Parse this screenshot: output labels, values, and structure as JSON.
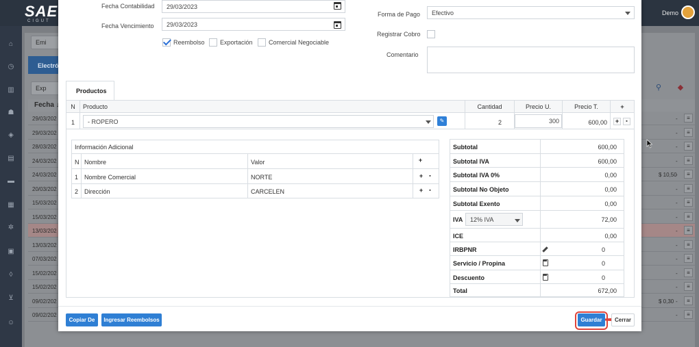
{
  "app": {
    "logo": "SAE",
    "logo_sub": "CIGUT",
    "user": "Demo",
    "bg_buttons": {
      "top_btn": "Emi",
      "tab": "Electró",
      "export_btn": "Exp"
    },
    "bg_table": {
      "header": "Fecha ↓",
      "rows": [
        {
          "date": "29/03/202",
          "dash": "-",
          "amount": ""
        },
        {
          "date": "29/03/202",
          "dash": "-",
          "amount": ""
        },
        {
          "date": "28/03/202",
          "dash": "-",
          "amount": ""
        },
        {
          "date": "24/03/202",
          "dash": "-",
          "amount": ""
        },
        {
          "date": "24/03/202",
          "dash": "-",
          "amount": "$ 10,50"
        },
        {
          "date": "20/03/202",
          "dash": "-",
          "amount": ""
        },
        {
          "date": "15/03/202",
          "dash": "-",
          "amount": ""
        },
        {
          "date": "15/03/202",
          "dash": "-",
          "amount": ""
        },
        {
          "date": "13/03/202",
          "dash": "-",
          "amount": ""
        },
        {
          "date": "13/03/202",
          "dash": "-",
          "amount": ""
        },
        {
          "date": "07/03/202",
          "dash": "-",
          "amount": ""
        },
        {
          "date": "15/02/202",
          "dash": "-",
          "amount": ""
        },
        {
          "date": "15/02/202",
          "dash": "-",
          "amount": ""
        },
        {
          "date": "09/02/202",
          "dash": "-",
          "amount": "$ 0,30"
        },
        {
          "date": "09/02/202",
          "dash": "-",
          "amount": ""
        }
      ]
    }
  },
  "form": {
    "fecha_contabilidad_label": "Fecha Contabilidad",
    "fecha_contabilidad_value": "29/03/2023",
    "fecha_vencimiento_label": "Fecha Vencimiento",
    "fecha_vencimiento_value": "29/03/2023",
    "reembolso_label": "Reembolso",
    "exportacion_label": "Exportación",
    "comercial_label": "Comercial Negociable",
    "forma_pago_label": "Forma de Pago",
    "forma_pago_value": "Efectivo",
    "registrar_cobro_label": "Registrar Cobro",
    "comentario_label": "Comentario"
  },
  "products": {
    "tab_label": "Productos",
    "headers": {
      "n": "N",
      "producto": "Producto",
      "cantidad": "Cantidad",
      "precio_u": "Precio U.",
      "precio_t": "Precio T.",
      "add": "+"
    },
    "rows": [
      {
        "n": "1",
        "producto": "- ROPERO",
        "cantidad": "2",
        "precio_u": "300",
        "precio_t": "600,00"
      }
    ]
  },
  "info": {
    "title": "Información Adicional",
    "headers": {
      "n": "N",
      "nombre": "Nombre",
      "valor": "Valor"
    },
    "rows": [
      {
        "n": "1",
        "nombre": "Nombre Comercial",
        "valor": "NORTE"
      },
      {
        "n": "2",
        "nombre": "Dirección",
        "valor": "CARCELEN"
      }
    ]
  },
  "totals": {
    "subtotal": {
      "label": "Subtotal",
      "value": "600,00"
    },
    "subtotal_iva": {
      "label": "Subtotal IVA",
      "value": "600,00"
    },
    "subtotal_iva0": {
      "label": "Subtotal IVA 0%",
      "value": "0,00"
    },
    "subtotal_no_objeto": {
      "label": "Subtotal No Objeto",
      "value": "0,00"
    },
    "subtotal_exento": {
      "label": "Subtotal Exento",
      "value": "0,00"
    },
    "iva": {
      "label": "IVA",
      "select": "12% IVA",
      "value": "72,00"
    },
    "ice": {
      "label": "ICE",
      "value": "0,00"
    },
    "irbpnr": {
      "label": "IRBPNR",
      "value": "0"
    },
    "servicio": {
      "label": "Servicio / Propina",
      "value": "0"
    },
    "descuento": {
      "label": "Descuento",
      "value": "0"
    },
    "total": {
      "label": "Total",
      "value": "672,00"
    }
  },
  "footer": {
    "copiar_de": "Copiar De",
    "ingresar_reembolsos": "Ingresar Reembolsos",
    "guardar": "Guardar",
    "cerrar": "Cerrar"
  },
  "colors": {
    "primary": "#2f7fd4",
    "highlight": "#e0443a",
    "header_bg": "#2b3440"
  }
}
